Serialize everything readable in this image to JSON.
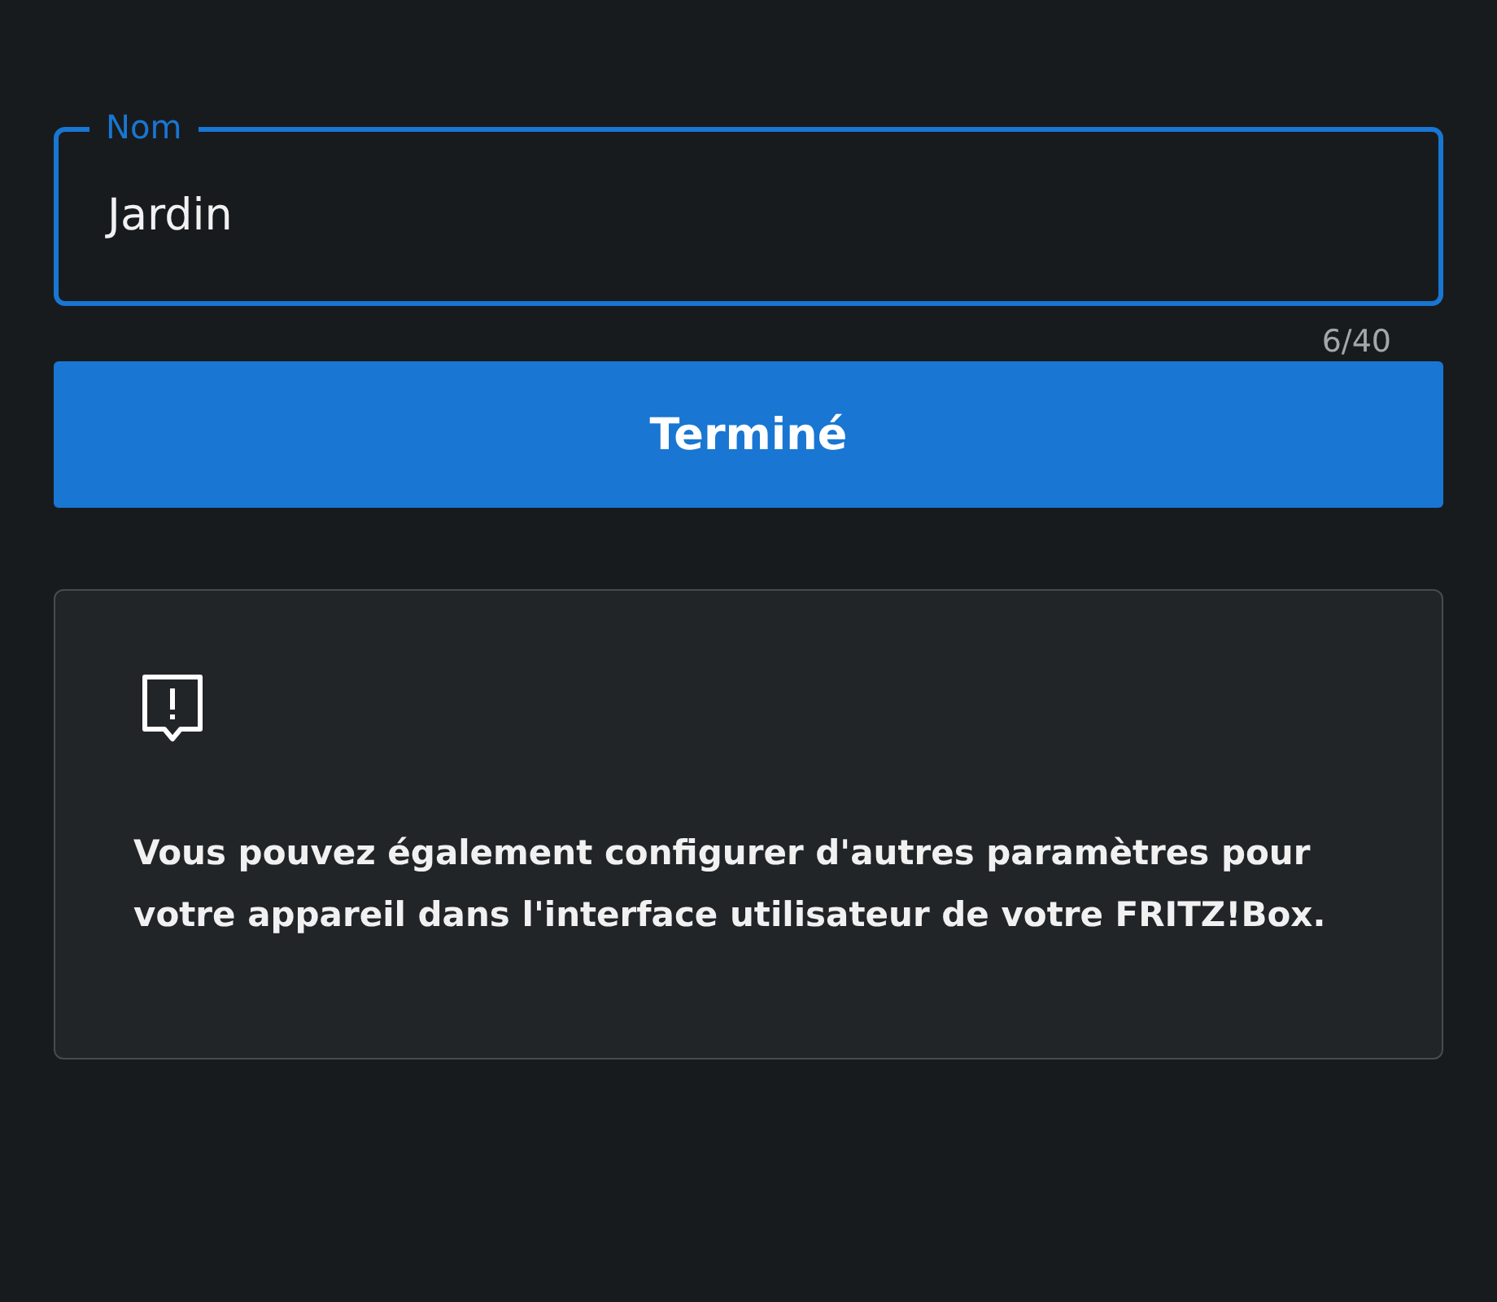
{
  "name_field": {
    "label": "Nom",
    "value": "Jardin",
    "focused": true,
    "counter": "6/40"
  },
  "done_button": {
    "label": "Terminé"
  },
  "info_card": {
    "text": "Vous pouvez également configurer d'autres paramètres pour votre appareil dans l'interface utilisateur de votre FRITZ!Box."
  }
}
